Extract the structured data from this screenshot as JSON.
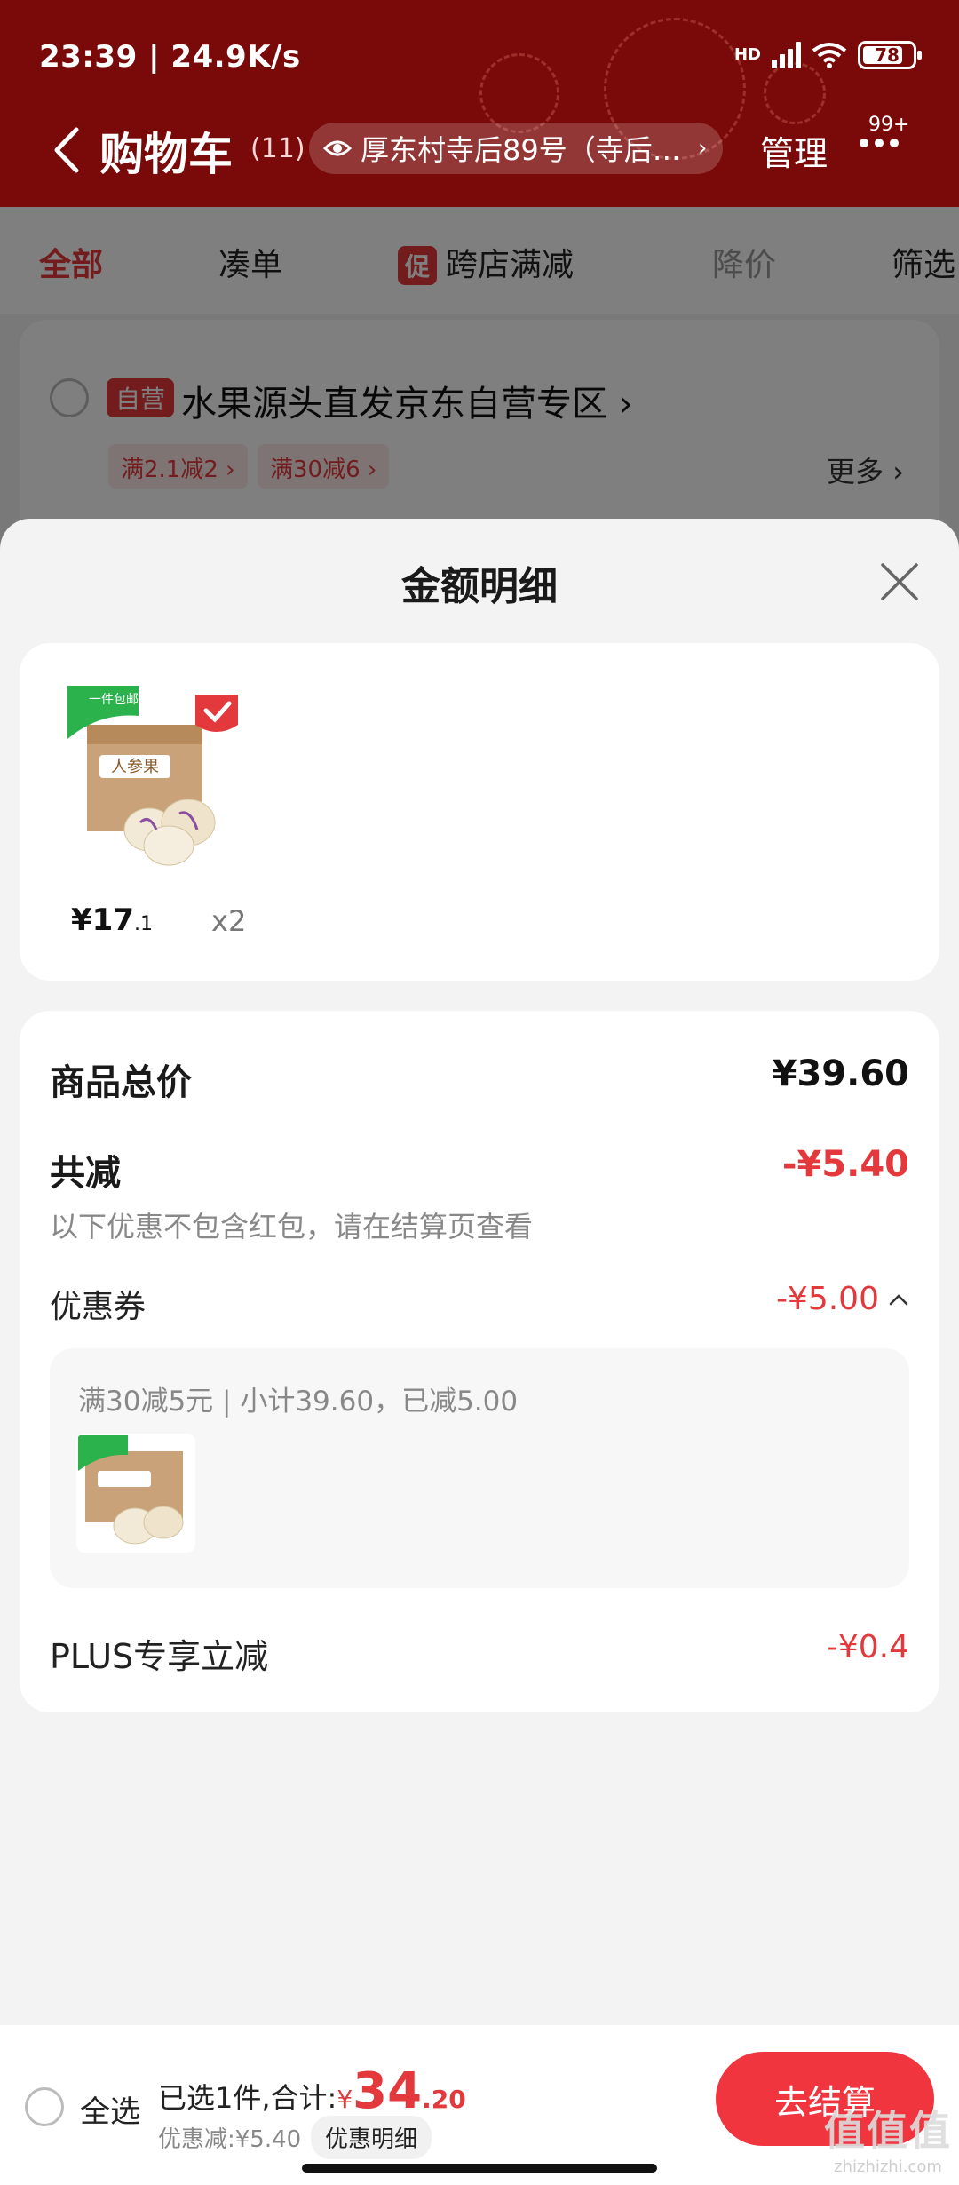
{
  "status_bar": {
    "time_speed": "23:39 | 24.9K/s",
    "network": "HD",
    "battery": "78"
  },
  "header": {
    "title": "购物车",
    "count": "(11)",
    "address": "厚东村寺后89号（寺后…",
    "manage": "管理",
    "message_badge": "99+"
  },
  "tabs": {
    "all": "全部",
    "coudan": "凑单",
    "promo_tag": "促",
    "cross_store": "跨店满减",
    "price_drop": "降价",
    "filter": "筛选"
  },
  "store": {
    "badge": "自营",
    "name": "水果源头直发京东自营专区",
    "coupons": [
      "满2.1减2 ›",
      "满30减6 ›"
    ],
    "more": "更多 ›"
  },
  "sheet": {
    "title": "金额明细",
    "product": {
      "price_yuan": "¥17",
      "price_fraction": ".1",
      "qty": "x2",
      "image": "renshenguo-fruit-box",
      "free_ship": "一件包邮",
      "box_brand": "人参果"
    },
    "total_label": "商品总价",
    "total_value": "¥39.60",
    "reduce_label": "共减",
    "reduce_value": "-¥5.40",
    "note": "以下优惠不包含红包，请在结算页查看",
    "coupon_label": "优惠券",
    "coupon_value": "-¥5.00",
    "coupon_desc": "满30减5元 | 小计39.60，已减5.00",
    "plus_label": "PLUS专享立减",
    "plus_value": "-¥0.4"
  },
  "bottom": {
    "select_all": "全选",
    "selected_prefix": "已选1件,合计:",
    "total_yen": "¥",
    "total_int": "34",
    "total_dec": ".20",
    "discount": "优惠减:¥5.40",
    "detail_chip": "优惠明细",
    "checkout": "去结算"
  },
  "watermark": {
    "logo": "值值值",
    "site": "zhizhizhi.com"
  },
  "colors": {
    "header_red": "#7a0a0a",
    "accent_red": "#e4393c",
    "checkout_red": "#f0353f"
  }
}
